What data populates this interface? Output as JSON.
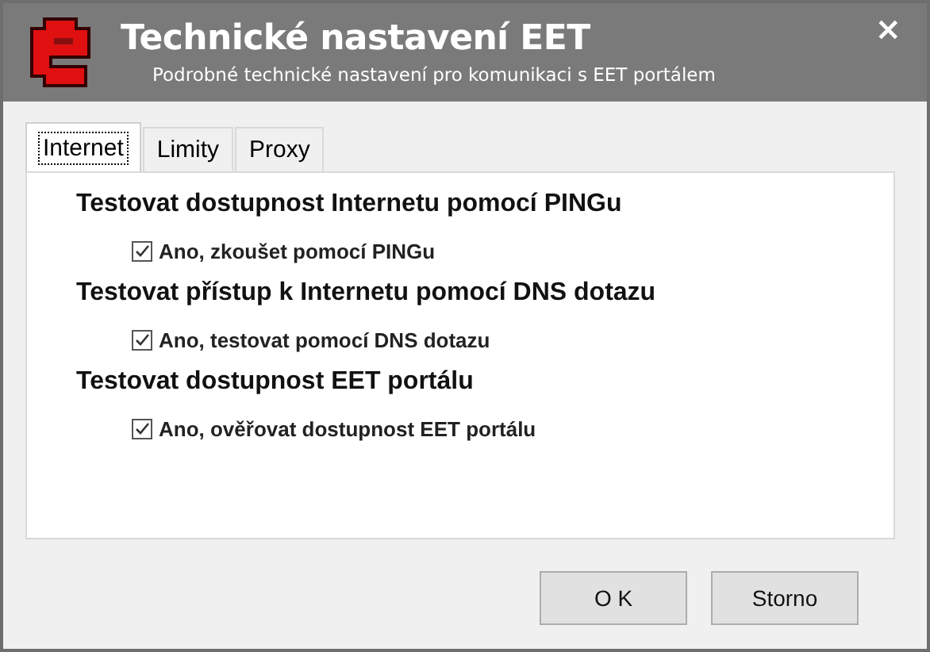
{
  "window": {
    "title": "Technické nastavení EET",
    "subtitle": "Podrobné technické nastavení pro komunikaci s EET portálem",
    "close": "×"
  },
  "tabs": [
    {
      "label": "Internet",
      "selected": true
    },
    {
      "label": "Limity",
      "selected": false
    },
    {
      "label": "Proxy",
      "selected": false
    }
  ],
  "sections": [
    {
      "heading": "Testovat dostupnost Internetu pomocí PINGu",
      "option": {
        "label": "Ano, zkoušet pomocí PINGu",
        "checked": true
      }
    },
    {
      "heading": "Testovat přístup k Internetu pomocí DNS dotazu",
      "option": {
        "label": "Ano, testovat pomocí DNS dotazu",
        "checked": true
      }
    },
    {
      "heading": "Testovat dostupnost EET portálu",
      "option": {
        "label": "Ano, ověřovat dostupnost EET portálu",
        "checked": true
      }
    }
  ],
  "buttons": [
    "O K",
    "Storno"
  ]
}
